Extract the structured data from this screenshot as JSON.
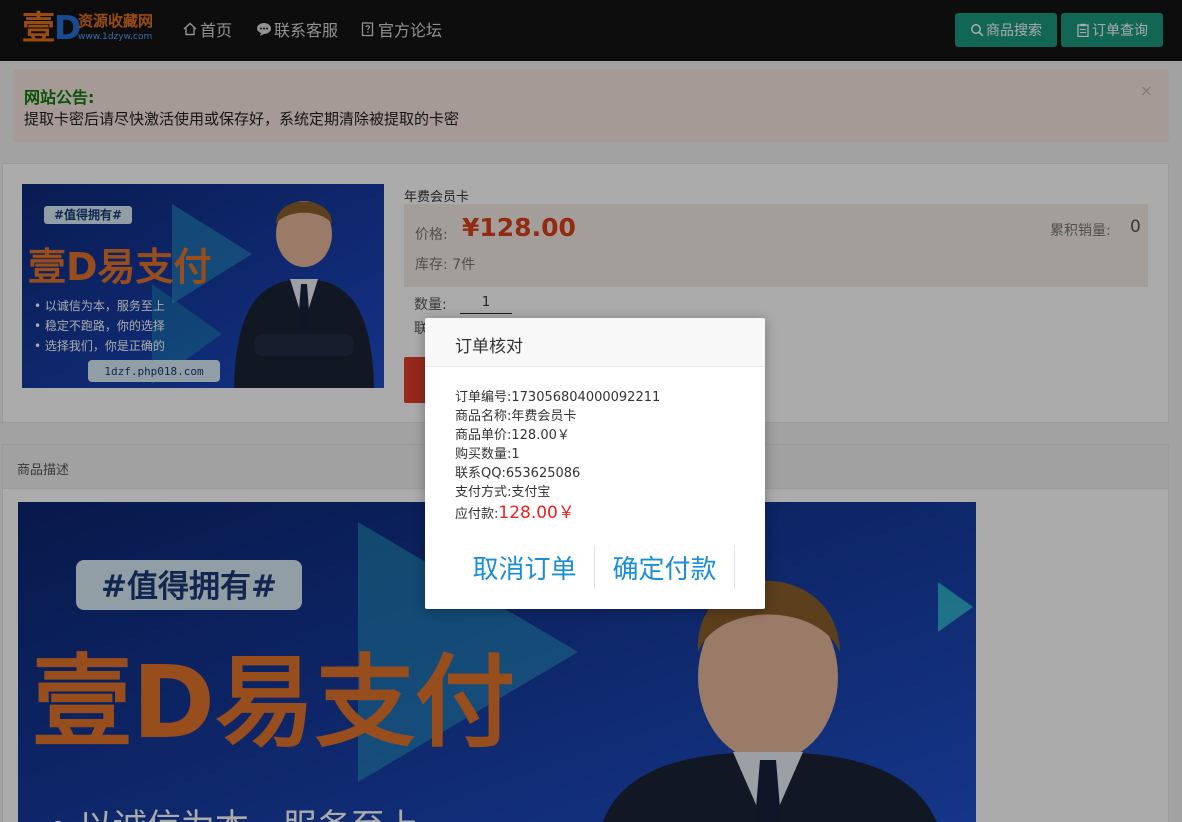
{
  "header": {
    "logo_big": "壹",
    "logo_d": "D",
    "logo_title": "资源收藏网",
    "logo_url": "www.1dzyw.com",
    "nav": [
      {
        "label": "首页",
        "icon": "home-icon"
      },
      {
        "label": "联系客服",
        "icon": "chat-icon"
      },
      {
        "label": "官方论坛",
        "icon": "forum-icon"
      }
    ],
    "search_label": "商品搜索",
    "order_label": "订单查询",
    "colors": {
      "bg": "#141414",
      "button": "#1a9a7e"
    }
  },
  "notice": {
    "title": "网站公告:",
    "text": "提取卡密后请尽快激活使用或保存好，系统定期清除被提取的卡密",
    "close": "×"
  },
  "product": {
    "banner": {
      "tag": "#值得拥有#",
      "headline": "壹D易支付",
      "bullets": [
        "以诚信为本，服务至上",
        "稳定不跑路，你的选择",
        "选择我们，你是正确的"
      ],
      "site": "1dzf.php018.com"
    },
    "name": "年费会员卡",
    "price_label": "价格:",
    "price": "¥128.00",
    "stock": "库存: 7件",
    "sales_label": "累积销量:",
    "sales_value": "0",
    "qty_label": "数量:",
    "qty_value": "1",
    "contact_label_partial": "联"
  },
  "description": {
    "header": "商品描述",
    "banner": {
      "tag": "#值得拥有#",
      "headline": "壹D易支付",
      "bullet_partial": "• 以诚信为本，服务至上"
    }
  },
  "dialog": {
    "title": "订单核对",
    "rows": [
      {
        "label": "订单编号:",
        "value": "173056804000092211"
      },
      {
        "label": "商品名称:",
        "value": "年费会员卡"
      },
      {
        "label": "商品单价:",
        "value": "128.00￥"
      },
      {
        "label": "购买数量:",
        "value": "1"
      },
      {
        "label": "联系QQ:",
        "value": "653625086"
      },
      {
        "label": "支付方式:",
        "value": "支付宝"
      }
    ],
    "pay_label": "应付款:",
    "pay_amount": "128.00￥",
    "cancel_label": "取消订单",
    "confirm_label": "确定付款",
    "colors": {
      "link": "#1a8ed6",
      "amount": "#f01e1e"
    }
  }
}
